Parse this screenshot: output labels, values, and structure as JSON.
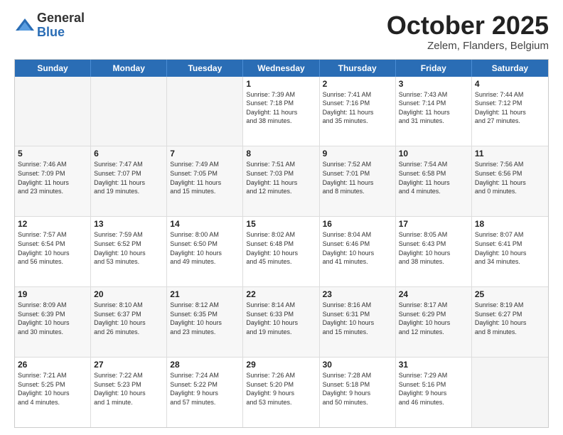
{
  "logo": {
    "general": "General",
    "blue": "Blue"
  },
  "header": {
    "month": "October 2025",
    "location": "Zelem, Flanders, Belgium"
  },
  "days": [
    "Sunday",
    "Monday",
    "Tuesday",
    "Wednesday",
    "Thursday",
    "Friday",
    "Saturday"
  ],
  "weeks": [
    [
      {
        "day": "",
        "info": ""
      },
      {
        "day": "",
        "info": ""
      },
      {
        "day": "",
        "info": ""
      },
      {
        "day": "1",
        "info": "Sunrise: 7:39 AM\nSunset: 7:18 PM\nDaylight: 11 hours\nand 38 minutes."
      },
      {
        "day": "2",
        "info": "Sunrise: 7:41 AM\nSunset: 7:16 PM\nDaylight: 11 hours\nand 35 minutes."
      },
      {
        "day": "3",
        "info": "Sunrise: 7:43 AM\nSunset: 7:14 PM\nDaylight: 11 hours\nand 31 minutes."
      },
      {
        "day": "4",
        "info": "Sunrise: 7:44 AM\nSunset: 7:12 PM\nDaylight: 11 hours\nand 27 minutes."
      }
    ],
    [
      {
        "day": "5",
        "info": "Sunrise: 7:46 AM\nSunset: 7:09 PM\nDaylight: 11 hours\nand 23 minutes."
      },
      {
        "day": "6",
        "info": "Sunrise: 7:47 AM\nSunset: 7:07 PM\nDaylight: 11 hours\nand 19 minutes."
      },
      {
        "day": "7",
        "info": "Sunrise: 7:49 AM\nSunset: 7:05 PM\nDaylight: 11 hours\nand 15 minutes."
      },
      {
        "day": "8",
        "info": "Sunrise: 7:51 AM\nSunset: 7:03 PM\nDaylight: 11 hours\nand 12 minutes."
      },
      {
        "day": "9",
        "info": "Sunrise: 7:52 AM\nSunset: 7:01 PM\nDaylight: 11 hours\nand 8 minutes."
      },
      {
        "day": "10",
        "info": "Sunrise: 7:54 AM\nSunset: 6:58 PM\nDaylight: 11 hours\nand 4 minutes."
      },
      {
        "day": "11",
        "info": "Sunrise: 7:56 AM\nSunset: 6:56 PM\nDaylight: 11 hours\nand 0 minutes."
      }
    ],
    [
      {
        "day": "12",
        "info": "Sunrise: 7:57 AM\nSunset: 6:54 PM\nDaylight: 10 hours\nand 56 minutes."
      },
      {
        "day": "13",
        "info": "Sunrise: 7:59 AM\nSunset: 6:52 PM\nDaylight: 10 hours\nand 53 minutes."
      },
      {
        "day": "14",
        "info": "Sunrise: 8:00 AM\nSunset: 6:50 PM\nDaylight: 10 hours\nand 49 minutes."
      },
      {
        "day": "15",
        "info": "Sunrise: 8:02 AM\nSunset: 6:48 PM\nDaylight: 10 hours\nand 45 minutes."
      },
      {
        "day": "16",
        "info": "Sunrise: 8:04 AM\nSunset: 6:46 PM\nDaylight: 10 hours\nand 41 minutes."
      },
      {
        "day": "17",
        "info": "Sunrise: 8:05 AM\nSunset: 6:43 PM\nDaylight: 10 hours\nand 38 minutes."
      },
      {
        "day": "18",
        "info": "Sunrise: 8:07 AM\nSunset: 6:41 PM\nDaylight: 10 hours\nand 34 minutes."
      }
    ],
    [
      {
        "day": "19",
        "info": "Sunrise: 8:09 AM\nSunset: 6:39 PM\nDaylight: 10 hours\nand 30 minutes."
      },
      {
        "day": "20",
        "info": "Sunrise: 8:10 AM\nSunset: 6:37 PM\nDaylight: 10 hours\nand 26 minutes."
      },
      {
        "day": "21",
        "info": "Sunrise: 8:12 AM\nSunset: 6:35 PM\nDaylight: 10 hours\nand 23 minutes."
      },
      {
        "day": "22",
        "info": "Sunrise: 8:14 AM\nSunset: 6:33 PM\nDaylight: 10 hours\nand 19 minutes."
      },
      {
        "day": "23",
        "info": "Sunrise: 8:16 AM\nSunset: 6:31 PM\nDaylight: 10 hours\nand 15 minutes."
      },
      {
        "day": "24",
        "info": "Sunrise: 8:17 AM\nSunset: 6:29 PM\nDaylight: 10 hours\nand 12 minutes."
      },
      {
        "day": "25",
        "info": "Sunrise: 8:19 AM\nSunset: 6:27 PM\nDaylight: 10 hours\nand 8 minutes."
      }
    ],
    [
      {
        "day": "26",
        "info": "Sunrise: 7:21 AM\nSunset: 5:25 PM\nDaylight: 10 hours\nand 4 minutes."
      },
      {
        "day": "27",
        "info": "Sunrise: 7:22 AM\nSunset: 5:23 PM\nDaylight: 10 hours\nand 1 minute."
      },
      {
        "day": "28",
        "info": "Sunrise: 7:24 AM\nSunset: 5:22 PM\nDaylight: 9 hours\nand 57 minutes."
      },
      {
        "day": "29",
        "info": "Sunrise: 7:26 AM\nSunset: 5:20 PM\nDaylight: 9 hours\nand 53 minutes."
      },
      {
        "day": "30",
        "info": "Sunrise: 7:28 AM\nSunset: 5:18 PM\nDaylight: 9 hours\nand 50 minutes."
      },
      {
        "day": "31",
        "info": "Sunrise: 7:29 AM\nSunset: 5:16 PM\nDaylight: 9 hours\nand 46 minutes."
      },
      {
        "day": "",
        "info": ""
      }
    ]
  ]
}
